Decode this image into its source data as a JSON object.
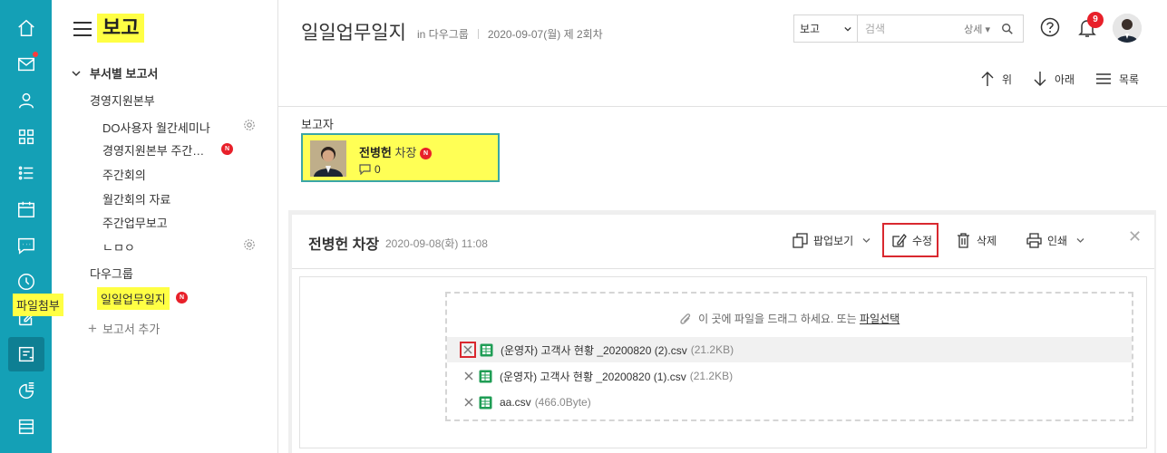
{
  "rail": {
    "items": [
      {
        "icon": "home-icon"
      },
      {
        "icon": "mail-icon",
        "badge": true
      },
      {
        "icon": "user-icon"
      },
      {
        "icon": "grid-icon"
      },
      {
        "icon": "list-icon"
      },
      {
        "icon": "calendar-icon"
      },
      {
        "icon": "chat-icon"
      },
      {
        "icon": "clock-icon"
      },
      {
        "icon": "edit-icon",
        "badge": true
      },
      {
        "icon": "report-icon",
        "active": true
      },
      {
        "icon": "chart-icon"
      },
      {
        "icon": "stack-icon"
      }
    ],
    "color": "#14a0b6"
  },
  "sidebar": {
    "title": "보고",
    "section": "부서별 보고서",
    "group1": "경영지원본부",
    "items1": [
      "DO사용자 월간세미나",
      "경영지원본부 주간…",
      "주간회의",
      "월간회의 자료",
      "주간업무보고",
      "ㄴㅁㅇ"
    ],
    "group2": "다우그룹",
    "active_item": "일일업무일지",
    "new_badge": "N",
    "add_label": "보고서 추가"
  },
  "header": {
    "title": "일일업무일지",
    "in_group": "in 다우그룹",
    "date_info": "2020-09-07(월) 제 2회차",
    "search_select": "보고",
    "search_placeholder": "검색",
    "search_advanced": "상세",
    "notification_count": "9",
    "nav": {
      "up": "위",
      "down": "아래",
      "list": "목록"
    }
  },
  "reporter": {
    "label": "보고자",
    "name": "전병헌",
    "rank": "차장",
    "badge": "N",
    "comments": "0"
  },
  "post": {
    "author": "전병헌 차장",
    "date": "2020-09-08(화) 11:08",
    "tools": {
      "popup": "팝업보기",
      "edit": "수정",
      "delete": "삭제",
      "print": "인쇄"
    },
    "attach_label": "파일첨부",
    "drop_msg": "이 곳에 파일을 드래그 하세요. 또는",
    "drop_pick": "파일선택",
    "files": [
      {
        "name": "(운영자) 고객사 현황 _20200820 (2).csv",
        "size": "(21.2KB)"
      },
      {
        "name": "(운영자) 고객사 현황 _20200820 (1).csv",
        "size": "(21.2KB)"
      },
      {
        "name": "aa.csv",
        "size": "(466.0Byte)"
      }
    ]
  }
}
